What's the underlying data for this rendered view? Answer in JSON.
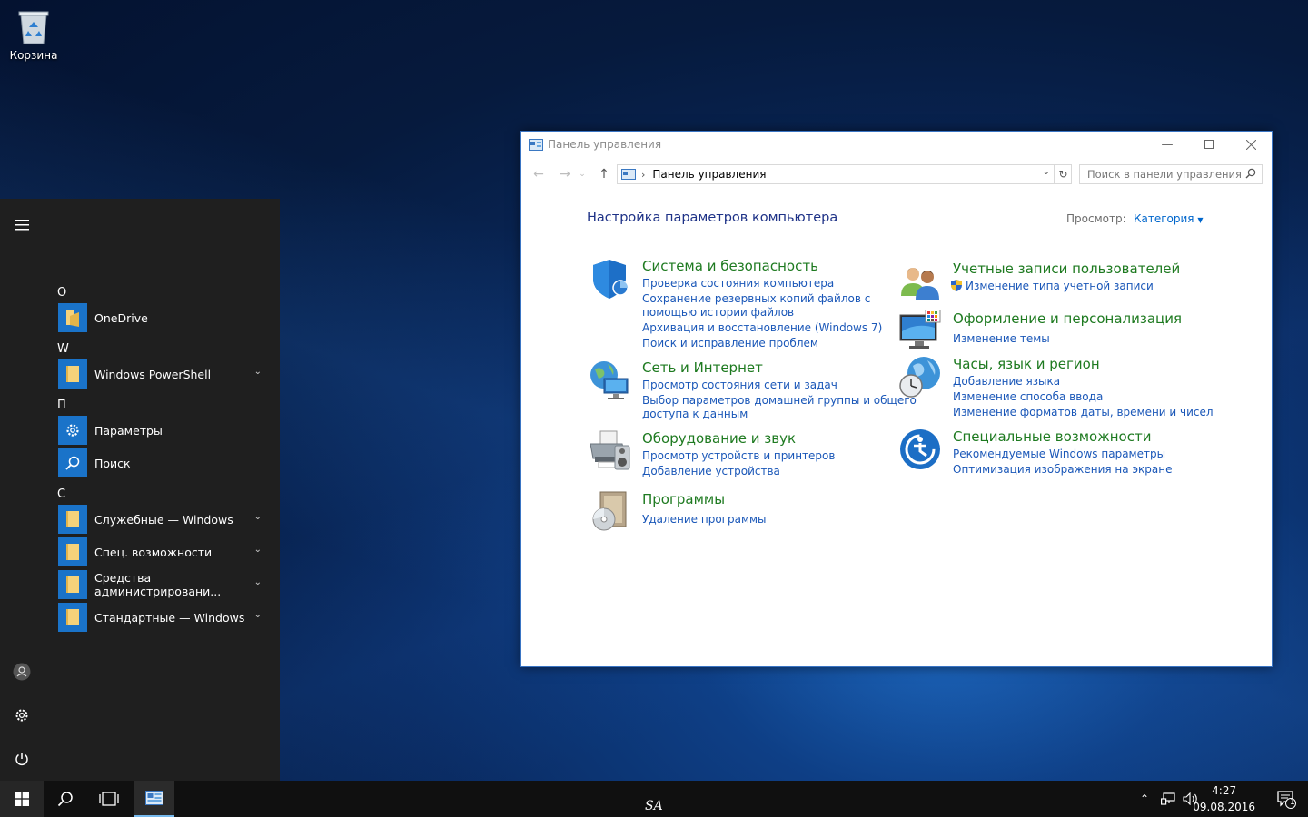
{
  "desktop": {
    "recycle_bin_label": "Корзина",
    "watermark": "SA"
  },
  "start_menu": {
    "sections": [
      {
        "letter": "O",
        "apps": [
          {
            "label": "OneDrive",
            "icon": "onedrive-icon",
            "expandable": false
          }
        ]
      },
      {
        "letter": "W",
        "apps": [
          {
            "label": "Windows PowerShell",
            "icon": "folder-icon",
            "expandable": true
          }
        ]
      },
      {
        "letter": "П",
        "apps": [
          {
            "label": "Параметры",
            "icon": "gear-icon",
            "expandable": false
          },
          {
            "label": "Поиск",
            "icon": "search-icon",
            "expandable": false
          }
        ]
      },
      {
        "letter": "С",
        "apps": [
          {
            "label": "Служебные — Windows",
            "icon": "folder-icon",
            "expandable": true
          },
          {
            "label": "Спец. возможности",
            "icon": "folder-icon",
            "expandable": true
          },
          {
            "label": "Средства администрировани...",
            "icon": "folder-icon",
            "expandable": true
          },
          {
            "label": "Стандартные — Windows",
            "icon": "folder-icon",
            "expandable": true
          }
        ]
      }
    ]
  },
  "taskbar": {
    "time": "4:27",
    "date": "09.08.2016",
    "notifications_count": "1"
  },
  "window": {
    "title": "Панель управления",
    "address": "Панель управления",
    "search_placeholder": "Поиск в панели управления",
    "heading": "Настройка параметров компьютера",
    "view_by_label": "Просмотр:",
    "view_by_value": "Категория",
    "categories": [
      {
        "title": "Система и безопасность",
        "links": [
          "Проверка состояния компьютера",
          "Сохранение резервных копий файлов с",
          "помощью истории файлов",
          "Архивация и восстановление (Windows 7)",
          "Поиск и исправление проблем"
        ]
      },
      {
        "title": "Сеть и Интернет",
        "links": [
          "Просмотр состояния сети и задач",
          "Выбор параметров домашней группы и общего",
          "доступа к данным"
        ]
      },
      {
        "title": "Оборудование и звук",
        "links": [
          "Просмотр устройств и принтеров",
          "Добавление устройства"
        ]
      },
      {
        "title": "Программы",
        "links": [
          "Удаление программы"
        ]
      },
      {
        "title": "Учетные записи пользователей",
        "links": [
          "Изменение типа учетной записи"
        ]
      },
      {
        "title": "Оформление и персонализация",
        "links": [
          "Изменение темы"
        ]
      },
      {
        "title": "Часы, язык и регион",
        "links": [
          "Добавление языка",
          "Изменение способа ввода",
          "Изменение форматов даты, времени и чисел"
        ]
      },
      {
        "title": "Специальные возможности",
        "links": [
          "Рекомендуемые Windows параметры",
          "Оптимизация изображения на экране"
        ]
      }
    ]
  },
  "colors": {
    "accent": "#1a73c9",
    "link": "#1a57b8",
    "category_title": "#1e7a20",
    "heading": "#1e3287"
  }
}
